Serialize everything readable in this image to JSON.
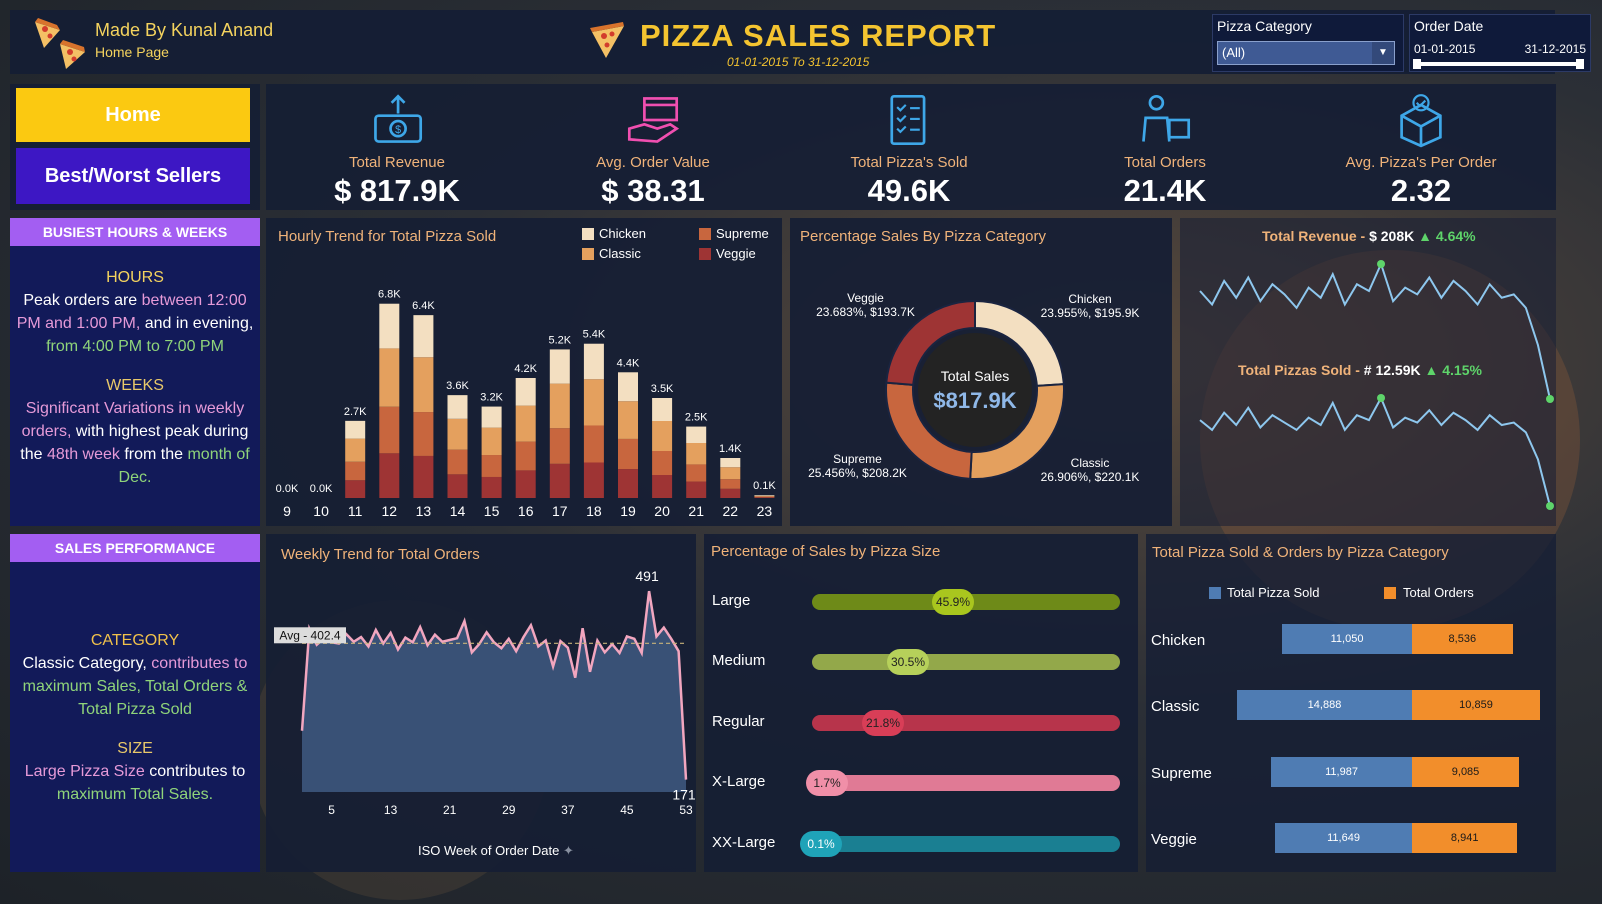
{
  "header": {
    "author": "Made By Kunal Anand",
    "page": "Home Page",
    "title": "PIZZA SALES REPORT",
    "date_range": "01-01-2015 To 31-12-2015",
    "filter_category_label": "Pizza Category",
    "filter_category_value": "(All)",
    "filter_date_label": "Order Date",
    "filter_date_start": "01-01-2015",
    "filter_date_end": "31-12-2015"
  },
  "nav": {
    "home": "Home",
    "best_worst": "Best/Worst Sellers"
  },
  "kpis": [
    {
      "label": "Total Revenue",
      "value": "$ 817.9K",
      "icon": "money-icon"
    },
    {
      "label": "Avg. Order Value",
      "value": "$ 38.31",
      "icon": "hand-box-icon"
    },
    {
      "label": "Total Pizza's Sold",
      "value": "49.6K",
      "icon": "checklist-icon"
    },
    {
      "label": "Total Orders",
      "value": "21.4K",
      "icon": "delivery-icon"
    },
    {
      "label": "Avg. Pizza's Per Order",
      "value": "2.32",
      "icon": "badge-box-icon"
    }
  ],
  "busiest": {
    "heading": "BUSIEST HOURS & WEEKS",
    "hours_title": "HOURS",
    "hours_p1": "Peak orders are ",
    "hours_p2": "between 12:00 PM and 1:00 PM,",
    "hours_p3": " and in evening, ",
    "hours_p4": "from  4:00 PM  to 7:00 PM",
    "weeks_title": "WEEKS",
    "weeks_p1": "Significant Variations in weekly orders,",
    "weeks_p2": " with highest peak during the ",
    "weeks_p3": "48th week",
    "weeks_p4": " from the ",
    "weeks_p5": "month of Dec."
  },
  "performance": {
    "heading": "SALES PERFORMANCE",
    "cat_title": "CATEGORY",
    "cat_p1": "Classic Category,",
    "cat_p2": " contributes to ",
    "cat_p3": "maximum Sales, Total Orders & Total Pizza Sold",
    "size_title": "SIZE",
    "size_p1": "Large Pizza Size",
    "size_p2": " contributes to ",
    "size_p3": "maximum Total Sales."
  },
  "hourly": {
    "title": "Hourly Trend for Total Pizza Sold",
    "legend": [
      "Chicken",
      "Supreme",
      "Classic",
      "Veggie"
    ],
    "colors": {
      "Chicken": "#f3dfc1",
      "Classic": "#e4a05e",
      "Supreme": "#c8663e",
      "Veggie": "#9e3434"
    }
  },
  "pie": {
    "title": "Percentage Sales By Pizza Category",
    "center_label": "Total Sales",
    "center_value": "$817.9K",
    "labels": [
      {
        "name": "Chicken",
        "detail": "23.955%, $195.9K"
      },
      {
        "name": "Classic",
        "detail": "26.906%, $220.1K"
      },
      {
        "name": "Supreme",
        "detail": "25.456%, $208.2K"
      },
      {
        "name": "Veggie",
        "detail": "23.683%, $193.7K"
      }
    ]
  },
  "sparks": {
    "rev_label": "Total Revenue -",
    "rev_value": "$ 208K",
    "rev_change": "▲ 4.64%",
    "pizza_label": "Total Pizzas Sold -",
    "pizza_value": "# 12.59K",
    "pizza_change": "▲ 4.15%"
  },
  "weekly": {
    "title": "Weekly Trend for Total Orders",
    "avg_label": "Avg - 402.4",
    "max_label": "491",
    "min_label": "171",
    "xlabel": "ISO Week of Order Date"
  },
  "size": {
    "title": "Percentage of Sales by Pizza Size",
    "rows": [
      {
        "name": "Large",
        "label": "45.9%",
        "value": 45.9
      },
      {
        "name": "Medium",
        "label": "30.5%",
        "value": 30.5
      },
      {
        "name": "Regular",
        "label": "21.8%",
        "value": 21.8
      },
      {
        "name": "X-Large",
        "label": "1.7%",
        "value": 1.7
      },
      {
        "name": "XX-Large",
        "label": "0.1%",
        "value": 0.1
      }
    ]
  },
  "catbars": {
    "title": "Total Pizza Sold & Orders by Pizza Category",
    "legend_sold": "Total Pizza Sold",
    "legend_orders": "Total Orders",
    "sold_color": "#4f7cb3",
    "orders_color": "#f28e2b"
  },
  "chart_data": [
    {
      "type": "bar",
      "title": "Hourly Trend for Total Pizza Sold",
      "categories": [
        "9",
        "10",
        "11",
        "12",
        "13",
        "14",
        "15",
        "16",
        "17",
        "18",
        "19",
        "20",
        "21",
        "22",
        "23"
      ],
      "totals": [
        "0.0K",
        "0.0K",
        "2.7K",
        "6.8K",
        "6.4K",
        "3.6K",
        "3.2K",
        "4.2K",
        "5.2K",
        "5.4K",
        "4.4K",
        "3.5K",
        "2.5K",
        "1.4K",
        "0.1K"
      ],
      "total_values": [
        0.004,
        0.008,
        2.7,
        6.8,
        6.4,
        3.6,
        3.2,
        4.2,
        5.2,
        5.4,
        4.4,
        3.5,
        2.5,
        1.4,
        0.1
      ],
      "stack_order": [
        "Veggie",
        "Supreme",
        "Classic",
        "Chicken"
      ],
      "share": [
        0.23,
        0.24,
        0.3,
        0.23
      ]
    },
    {
      "type": "line",
      "title": "Weekly Trend for Total Orders",
      "x_ticks": [
        "5",
        "13",
        "21",
        "29",
        "37",
        "45",
        "53"
      ],
      "x": [
        1,
        2,
        3,
        4,
        5,
        6,
        7,
        8,
        9,
        10,
        11,
        12,
        13,
        14,
        15,
        16,
        17,
        18,
        19,
        20,
        21,
        22,
        23,
        24,
        25,
        26,
        27,
        28,
        29,
        30,
        31,
        32,
        33,
        34,
        35,
        36,
        37,
        38,
        39,
        40,
        41,
        42,
        43,
        44,
        45,
        46,
        47,
        48,
        49,
        50,
        51,
        52,
        53
      ],
      "values": [
        254,
        427,
        400,
        411,
        404,
        402,
        418,
        405,
        413,
        397,
        425,
        402,
        420,
        392,
        412,
        404,
        430,
        399,
        417,
        405,
        408,
        411,
        440,
        387,
        401,
        421,
        404,
        394,
        410,
        389,
        413,
        433,
        397,
        407,
        363,
        406,
        395,
        344,
        428,
        354,
        407,
        387,
        401,
        386,
        414,
        410,
        386,
        491,
        414,
        429,
        410,
        389,
        171
      ],
      "avg": 402.4,
      "xlabel": "ISO Week of Order Date"
    },
    {
      "type": "pie",
      "title": "Percentage Sales By Pizza Category",
      "categories": [
        "Chicken",
        "Classic",
        "Supreme",
        "Veggie"
      ],
      "values": [
        23.955,
        26.906,
        25.456,
        23.683
      ],
      "revenue": [
        "$195.9K",
        "$220.1K",
        "$208.2K",
        "$193.7K"
      ]
    },
    {
      "type": "bar",
      "title": "Total Pizza Sold & Orders by Pizza Category",
      "categories": [
        "Chicken",
        "Classic",
        "Supreme",
        "Veggie"
      ],
      "series": [
        {
          "name": "Total Pizza Sold",
          "values": [
            11050,
            14888,
            11987,
            11649
          ],
          "labels": [
            "11,050",
            "14,888",
            "11,987",
            "11,649"
          ]
        },
        {
          "name": "Total Orders",
          "values": [
            8536,
            10859,
            9085,
            8941
          ],
          "labels": [
            "8,536",
            "10,859",
            "9,085",
            "8,941"
          ]
        }
      ]
    },
    {
      "type": "bar",
      "title": "Percentage of Sales by Pizza Size",
      "categories": [
        "Large",
        "Medium",
        "Regular",
        "X-Large",
        "XX-Large"
      ],
      "values": [
        45.9,
        30.5,
        21.8,
        1.7,
        0.1
      ]
    },
    {
      "type": "line",
      "title": "Total Revenue",
      "values": [
        62,
        58,
        65,
        60,
        66,
        59,
        64,
        61,
        57,
        63,
        60,
        67,
        58,
        64,
        62,
        70,
        59,
        63,
        61,
        66,
        60,
        65,
        62,
        58,
        64,
        60,
        61,
        57,
        46,
        30
      ]
    },
    {
      "type": "line",
      "title": "Total Pizzas Sold",
      "values": [
        61,
        57,
        64,
        59,
        66,
        58,
        63,
        60,
        57,
        62,
        59,
        68,
        57,
        63,
        61,
        70,
        58,
        62,
        60,
        65,
        59,
        64,
        61,
        57,
        63,
        59,
        60,
        56,
        45,
        26
      ]
    }
  ]
}
